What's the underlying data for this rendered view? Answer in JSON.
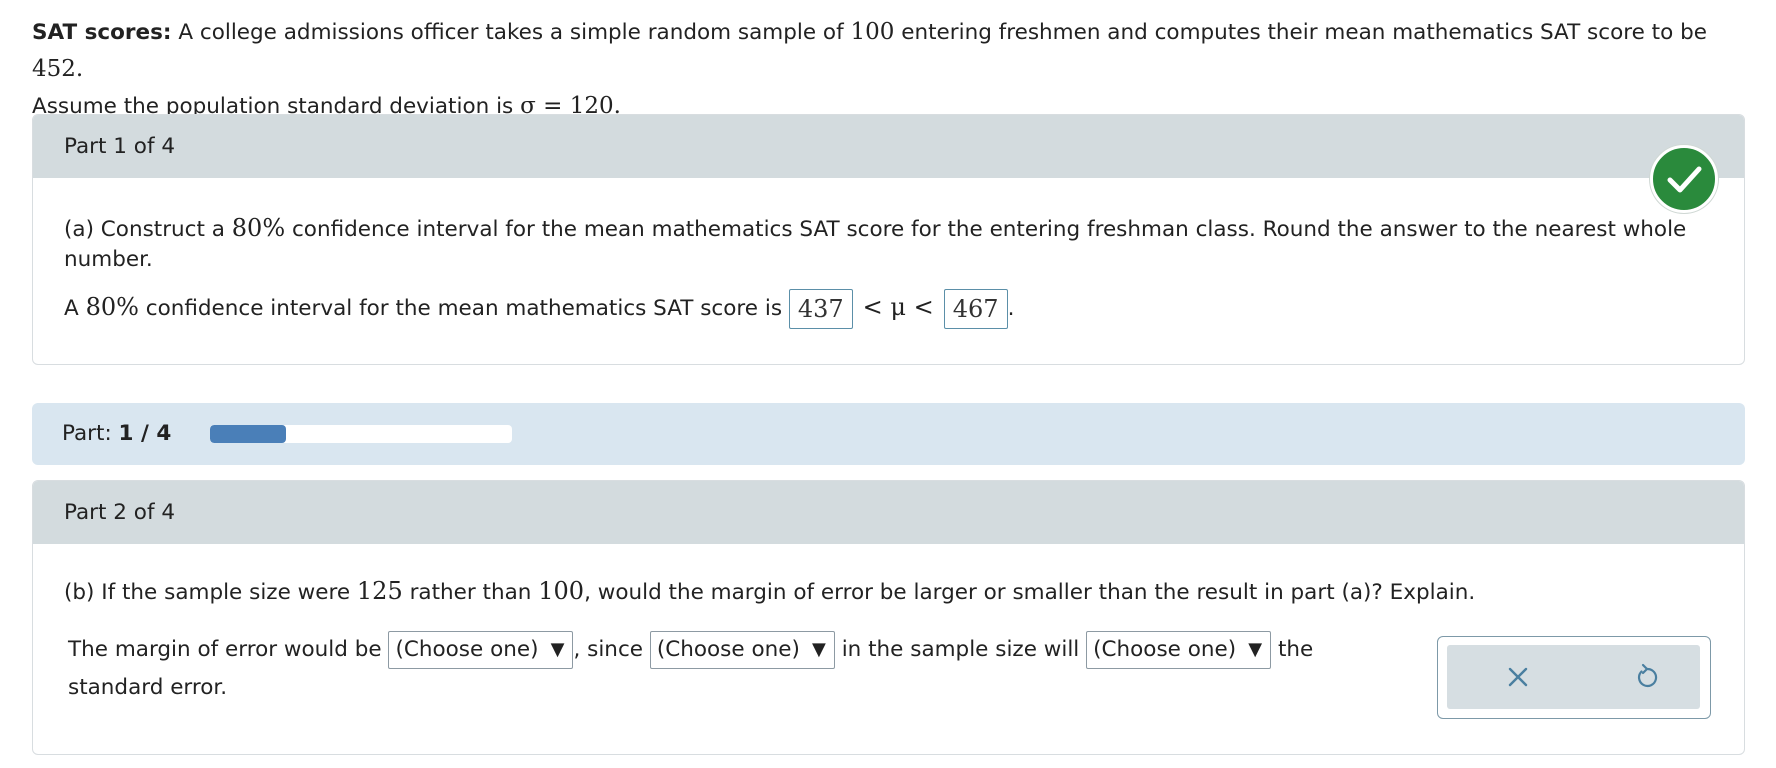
{
  "intro": {
    "title": "SAT scores:",
    "text_1": "A college admissions officer takes a simple random sample of",
    "sample_size": "100",
    "text_2": "entering freshmen and computes their mean mathematics SAT score to be",
    "mean": "452",
    "text_3": "Assume the population standard deviation is",
    "sigma_expr": "σ = 120"
  },
  "part1": {
    "header": "Part 1 of 4",
    "status": "check-icon",
    "question_a_prefix": "(a) Construct a",
    "question_pct": "80%",
    "question_a_suffix": "confidence interval for the mean mathematics SAT score for the entering freshman class. Round the answer to the nearest whole number.",
    "answer_prefix": "A",
    "answer_pct": "80%",
    "answer_mid": "confidence interval for the mean mathematics SAT score is",
    "lower": "437",
    "mu_expr": "< μ <",
    "upper": "467"
  },
  "progress": {
    "label": "Part:",
    "value": "1 / 4",
    "fraction": 0.25,
    "fill_color": "#4a7fb8"
  },
  "part2": {
    "header": "Part 2 of 4",
    "question_b_prefix": "(b) If the sample size were",
    "n_new": "125",
    "question_b_mid": "rather than",
    "n_old": "100",
    "question_b_suffix": ", would the margin of error be larger or smaller than the result in part (a)? Explain.",
    "sentence_1": "The margin of error would be",
    "sentence_2": ", since",
    "sentence_3": "in the sample size will",
    "sentence_4": "the",
    "sentence_5": "standard error.",
    "select_1": "(Choose one)",
    "select_2": "(Choose one)",
    "select_3": "(Choose one)",
    "arrow": "▼"
  },
  "toolbox": {
    "clear_icon": "close-icon",
    "reset_icon": "undo-icon"
  }
}
